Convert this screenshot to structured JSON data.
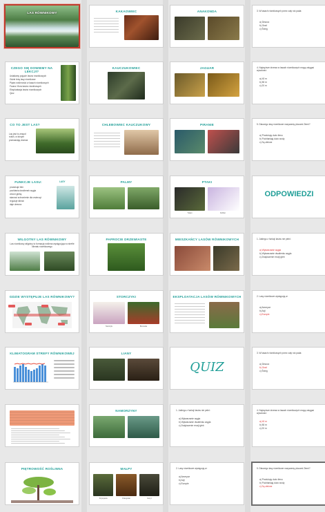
{
  "slides_col1": [
    {
      "title": "LAS RÓWNIKOWY"
    },
    {
      "title": "CZEGO SIĘ DOWIEMY NA LEKCJI?",
      "lines": [
        "Ustaliamy pojęcie lasów równikowych",
        "Gdzie leżą lasy równikowe",
        "Piętra roślinności w lasach równikowych",
        "Fauna i flora lasów równikowych",
        "Eksploatacja lasów równikowych",
        "Quiz"
      ]
    },
    {
      "title": "CO TO JEST LAS?",
      "text": "Las jest to zespół roślin, w którym przeważają drzewa"
    },
    {
      "title": "FUNKCJE LASU:",
      "lines": [
        "produkuje tlen",
        "pochłania dwutlenek węgla",
        "chroni glebę",
        "stanowi schronienie dla zwierząt",
        "reguluje klimat",
        "daje drewno"
      ],
      "side": "LASY"
    },
    {
      "title": "WILGOTNY LAS RÓWNIKOWY",
      "text": "Las równikowy wilgotny to formacja roślinna występująca w strefie klimatu równikowego"
    },
    {
      "title": "GDZIE WYSTĘPUJE LAS RÓWNIKOWY?"
    },
    {
      "title": "KLIMATOGRAM STREFY RÓWNIKOWEJ"
    },
    {
      "title": ""
    },
    {
      "title": "PIĘTROWOŚĆ ROŚLINNA"
    }
  ],
  "slides_col2": [
    {
      "title": "KAKAOWIEC"
    },
    {
      "title": "KAUCZUKOWIEC"
    },
    {
      "title": "CHLEBOWIEC KAUCZUKOWY"
    },
    {
      "title": "PALMY"
    },
    {
      "title": "PAPROCIE DRZEWIASTE"
    },
    {
      "title": "STORCZYKI",
      "captions": [
        "Storczyk",
        "Bromelia"
      ]
    },
    {
      "title": "LIANY"
    },
    {
      "title": "NAMORZYNY"
    },
    {
      "title": "MAŁPY",
      "captions": [
        "Szympans",
        "Orangutan",
        "Goryl"
      ]
    }
  ],
  "slides_col3": [
    {
      "title": "ANAKONDA"
    },
    {
      "title": "JAGUAR"
    },
    {
      "title": "PIRANIE"
    },
    {
      "title": "PTAKI",
      "captions": [
        "Tukan",
        "Koliber"
      ]
    },
    {
      "title": "MIESZKAŃCY LASÓW RÓWNIKOWYCH"
    },
    {
      "title": "EKSPLOATACJA LASÓW RÓWNIKOWYCH"
    },
    {
      "big": "QUIZ"
    },
    {
      "q": "1. Jakiego z funkcji lasów nie pełni:",
      "answers": [
        "a) Wytwarzanie węgla",
        "b) Wytwarzanie dwutlenku węgla",
        "c) Zwiększenie erozji gleb"
      ]
    },
    {
      "q": "2. Lasy równikowe występują w:",
      "answers": [
        "a) Ameryce",
        "b) Azji",
        "c) Europie"
      ]
    }
  ],
  "slides_col4": [
    {
      "q": "3. W lasach równikowych przez cały rok pada:",
      "answers": [
        "a) Deszcz",
        "b) Grad",
        "c) Śnieg"
      ]
    },
    {
      "q": "4. Najwyższe drzewa w lasach równikowych mogą osiągać wysokość:",
      "answers": [
        "a) 40 m",
        "b) 80 m",
        "c) 20 m"
      ]
    },
    {
      "q": "5. Dlaczego lasy równikowe nazywamy płucami Ziemi?",
      "answers": [
        "a) Produkują dużo tlenu",
        "b) Pochłaniają dużo wody",
        "c) Są zielone"
      ]
    },
    {
      "big": "ODPOWIEDZI"
    },
    {
      "q": "1. Jakiego z funkcji lasów nie pełni:",
      "answers": [
        "a) Wytwarzanie węgla",
        "b) Wytwarzanie dwutlenku węgla",
        "c) Zwiększenie erozji gleb"
      ],
      "correct": 0
    },
    {
      "q": "2. Lasy równikowe występują w:",
      "answers": [
        "a) Ameryce",
        "b) Azji",
        "c) Europie"
      ],
      "correct": 2
    },
    {
      "q": "3. W lasach równikowych przez cały rok pada:",
      "answers": [
        "a) Deszcz",
        "b) Grad",
        "c) Śnieg"
      ],
      "correct": 1
    },
    {
      "q": "4. Najwyższe drzewa w lasach równikowych mogą osiągać wysokość:",
      "answers": [
        "a) 40 m",
        "b) 80 m",
        "c) 20 m"
      ],
      "correct": 0
    },
    {
      "q": "5. Dlaczego lasy równikowe nazywamy płucami Ziemi?",
      "answers": [
        "a) Produkują dużo tlenu",
        "b) Pochłaniają dużo wody",
        "c) Są zielone"
      ],
      "correct": 2
    }
  ]
}
